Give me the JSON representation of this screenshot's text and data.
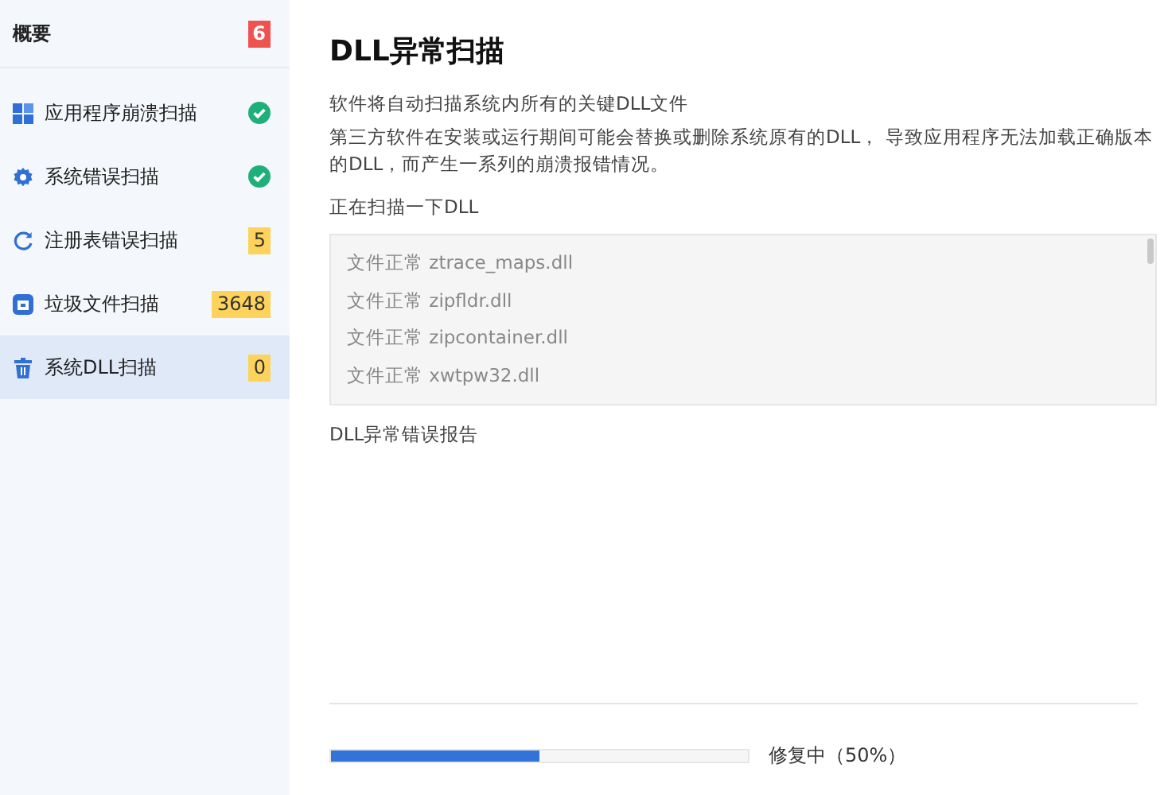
{
  "sidebar": {
    "header": {
      "label": "概要",
      "badge": "6",
      "color": "#ef5350"
    },
    "items": [
      {
        "label": "应用程序崩溃扫描",
        "kind": "check",
        "selected": false
      },
      {
        "label": "系统错误扫描",
        "kind": "check",
        "selected": false
      },
      {
        "label": "注册表错误扫描",
        "kind": "badge",
        "badge": "5",
        "color": "#fdd35c",
        "selected": false
      },
      {
        "label": "垃圾文件扫描",
        "kind": "badge",
        "badge": "3648",
        "color": "#fdd35c",
        "selected": false
      },
      {
        "label": "系统DLL扫描",
        "kind": "badge",
        "badge": "0",
        "color": "#fdd35c",
        "selected": true
      }
    ]
  },
  "main": {
    "title": "DLL异常扫描",
    "description": [
      "软件将自动扫描系统内所有的关键DLL文件",
      "第三方软件在安装或运行期间可能会替换或删除系统原有的DLL， 导致应用程序无法加载正确版本的DLL，而产生一系列的崩溃报错情况。"
    ],
    "scan_label": "正在扫描一下DLL",
    "scan_log": [
      "文件正常 ztrace_maps.dll",
      "文件正常 zipfldr.dll",
      "文件正常 zipcontainer.dll",
      "文件正常 xwtpw32.dll"
    ],
    "report_label": "DLL异常错误报告",
    "progress": {
      "level": 0.5,
      "reading": "修复中（50%）"
    }
  }
}
